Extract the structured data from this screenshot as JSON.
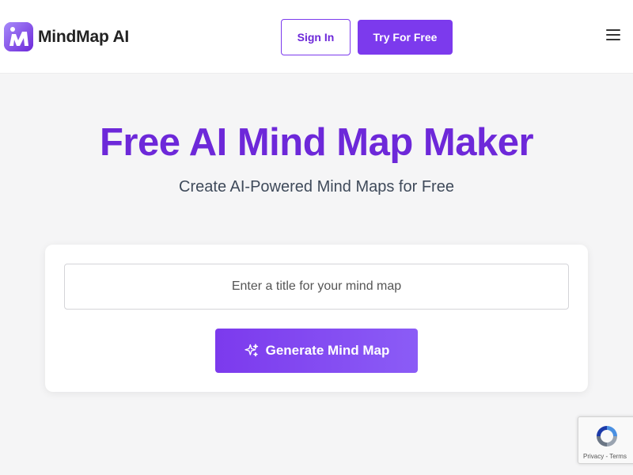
{
  "header": {
    "brand_name": "MindMap AI",
    "sign_in_label": "Sign In",
    "try_label": "Try For Free"
  },
  "hero": {
    "title": "Free AI Mind Map Maker",
    "subtitle": "Create AI-Powered Mind Maps for Free"
  },
  "form": {
    "title_placeholder": "Enter a title for your mind map",
    "title_value": "",
    "generate_label": "Generate Mind Map"
  },
  "recaptcha": {
    "links": "Privacy - Terms"
  },
  "colors": {
    "brand": "#7c3aed",
    "brand_dark": "#6d28d9",
    "page_bg": "#f5f5f6"
  },
  "icons": {
    "logo": "mindmap-logo-icon",
    "menu": "hamburger-menu-icon",
    "generate": "sparkle-icon",
    "recaptcha": "recaptcha-icon"
  }
}
